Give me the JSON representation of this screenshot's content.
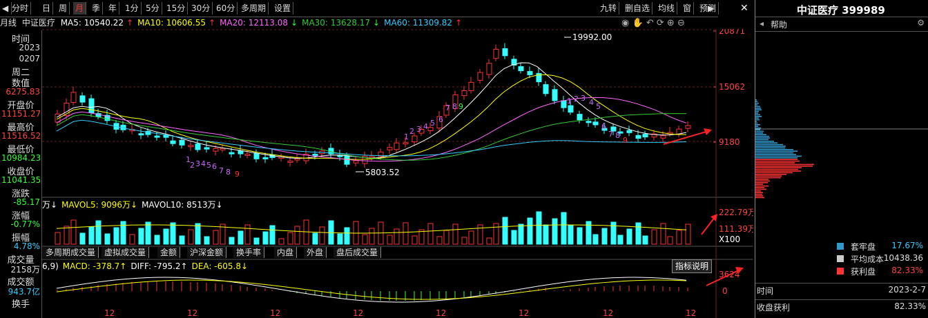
{
  "toolbar": {
    "left_items": [
      "分时",
      "日",
      "周",
      "月",
      "季",
      "年",
      "1分",
      "5分",
      "15分",
      "30分",
      "60分",
      "多周期",
      "设置"
    ],
    "active": "月",
    "right_items": [
      "九转",
      "删自选",
      "均线",
      "窗",
      "预测"
    ]
  },
  "title_row": {
    "period": "月线",
    "name": "中证医疗",
    "ma5": {
      "label": "MA5: 10540.22",
      "arrow": "↑",
      "color": "#ffffff"
    },
    "ma10": {
      "label": "MA10: 10606.55",
      "arrow": "↑",
      "color": "#ffff00"
    },
    "ma20": {
      "label": "MA20: 12113.08",
      "arrow": "↓",
      "color": "#ff66ff"
    },
    "ma30": {
      "label": "MA30: 13628.17",
      "arrow": "↓",
      "color": "#33cc33"
    },
    "ma60": {
      "label": "MA60: 11309.82",
      "arrow": "↑",
      "color": "#33ccff"
    }
  },
  "left_panel": [
    {
      "label": "时间",
      "value": "2023",
      "color": "#dddddd"
    },
    {
      "label": "",
      "value": "0207",
      "color": "#dddddd"
    },
    {
      "label": "周二",
      "value": "",
      "color": "#dddddd"
    },
    {
      "label": "数值",
      "value": "6275.83",
      "color": "#ff4444"
    },
    {
      "label": "开盘价",
      "value": "11151.27",
      "color": "#ff4444"
    },
    {
      "label": "最高价",
      "value": "11516.52",
      "color": "#ff4444"
    },
    {
      "label": "最低价",
      "value": "10984.23",
      "color": "#33ff33"
    },
    {
      "label": "收盘价",
      "value": "11041.35",
      "color": "#33ff33"
    },
    {
      "label": "涨跌",
      "value": "-85.17",
      "color": "#33ff33"
    },
    {
      "label": "涨幅",
      "value": "-0.77%",
      "color": "#33ff33"
    },
    {
      "label": "振幅",
      "value": "4.78%",
      "color": "#33ccff"
    },
    {
      "label": "成交量",
      "value": "2158万",
      "color": "#dddddd"
    },
    {
      "label": "成交额",
      "value": "943.7亿",
      "color": "#33ccff"
    },
    {
      "label": "换手",
      "value": "",
      "color": "#dddddd"
    }
  ],
  "price_axis": [
    "20871",
    "15062",
    "9180"
  ],
  "volume_axis": [
    "222.79万",
    "111.39万",
    "X100"
  ],
  "macd_axis": [
    "3624",
    "0"
  ],
  "annotations": {
    "high": "19992.00",
    "low": "5803.52"
  },
  "volume_title": {
    "prefix": "万↓",
    "mavol5": "MAVOL5: 9096万↓",
    "mavol10": "MAVOL10: 8513万↓"
  },
  "macd_title": {
    "prefix": "6,9)",
    "macd": "MACD: -378.7↑",
    "diff": "DIFF: -795.2↑",
    "dea": "DEA: -605.8↓"
  },
  "tabs": [
    "多周期成交量",
    "虚拟成交量",
    "金额",
    "沪深金额",
    "换手率",
    "内盘",
    "外盘",
    "盘后成交量"
  ],
  "explain_button": "指标说明",
  "x_ticks": [
    "12",
    "12",
    "12",
    "12",
    "12",
    "12",
    "12",
    "12"
  ],
  "right_panel": {
    "title": "中证医疗 399989",
    "help": "帮助",
    "legend": [
      {
        "label": "套牢盘",
        "value": "17.67%",
        "color": "#3399cc",
        "valcolor": "#33ccff"
      },
      {
        "label": "平均成本",
        "value": "10438.36",
        "color": "#cccccc",
        "valcolor": "#dddddd"
      },
      {
        "label": "获利盘",
        "value": "82.33%",
        "color": "#ff3333",
        "valcolor": "#ff4444"
      }
    ],
    "footer": [
      {
        "k": "时间",
        "v": "2023-2-7"
      },
      {
        "k": "收盘获利",
        "v": "82.33%"
      }
    ]
  },
  "nine_turn": [
    {
      "text": "1",
      "color": "#cc66ff"
    },
    {
      "text": "2",
      "color": "#cc66ff"
    },
    {
      "text": "3",
      "color": "#cc66ff"
    },
    {
      "text": "4",
      "color": "#cc66ff"
    },
    {
      "text": "5",
      "color": "#cc66ff"
    },
    {
      "text": "6",
      "color": "#cc66ff"
    },
    {
      "text": "7",
      "color": "#cc66ff"
    },
    {
      "text": "8",
      "color": "#cc66ff"
    },
    {
      "text": "9",
      "color": "#ff3333"
    },
    {
      "text": "1",
      "color": "#cc66ff"
    },
    {
      "text": "2",
      "color": "#cc66ff"
    },
    {
      "text": "3",
      "color": "#cc66ff"
    },
    {
      "text": "4",
      "color": "#cc66ff"
    },
    {
      "text": "5",
      "color": "#cc66ff"
    },
    {
      "text": "6",
      "color": "#cc66ff"
    },
    {
      "text": "7",
      "color": "#cc66ff"
    },
    {
      "text": "8",
      "color": "#cc66ff"
    },
    {
      "text": "9",
      "color": "#33ff33"
    },
    {
      "text": "1",
      "color": "#cc66ff"
    },
    {
      "text": "2",
      "color": "#cc66ff"
    },
    {
      "text": "3",
      "color": "#cc66ff"
    },
    {
      "text": "4",
      "color": "#cc66ff"
    },
    {
      "text": "5",
      "color": "#cc66ff"
    },
    {
      "text": "6",
      "color": "#cc66ff"
    },
    {
      "text": "7",
      "color": "#cc66ff"
    },
    {
      "text": "8",
      "color": "#cc66ff"
    },
    {
      "text": "9",
      "color": "#ff3333"
    }
  ]
}
